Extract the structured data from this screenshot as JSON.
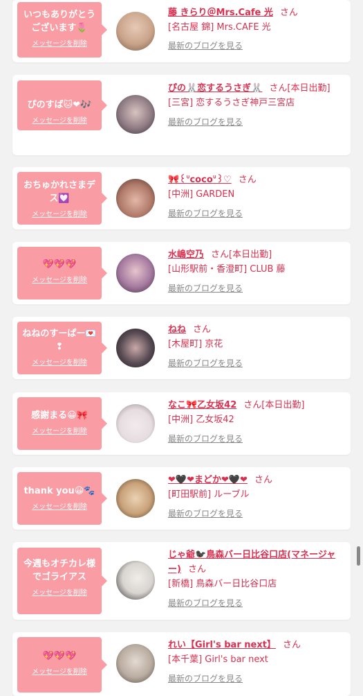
{
  "theme": {
    "accent": "#fa9ca4",
    "link": "#d9304f",
    "muted": "#888888"
  },
  "delete_label": "メッセージを削除",
  "blog_label": "最新のブログを見る",
  "san_label": "さん",
  "cards": [
    {
      "message": "いつもありがとうございます🌷",
      "name": "藤 きらり＠Mrs.Cafe 光",
      "status": "",
      "shop": "[名古屋 錦] Mrs.CAFE 光",
      "avatar_color": "#c9a48a"
    },
    {
      "message": "ぴのすば🐱❤🎶",
      "name": "ぴの🐰恋するうさぎ🐰",
      "status": "[本日出勤]",
      "shop": "[三宮] 恋するうさぎ神戸三宮店",
      "avatar_color": "#8f7c84"
    },
    {
      "message": "おちゅかれさまデス💟",
      "name": "🎀꒰ᐡcocoᐡ꒱♡",
      "status": "",
      "shop": "[中洲] GARDEN",
      "avatar_color": "#b07a6a"
    },
    {
      "message": "💖💖💖",
      "name": "水嶋空乃",
      "status": "[本日出勤]",
      "shop": "[山形駅前・香澄町] CLUB 藤",
      "avatar_color": "#a57aa0"
    },
    {
      "message": "ねねのすーぱー💌 ❢",
      "name": "ねね",
      "status": "",
      "shop": "[木屋町] 京花",
      "avatar_color": "#5a4c55"
    },
    {
      "message": "感謝まる😀🎀",
      "name": "なこ🎀乙女坂42",
      "status": "[本日出勤]",
      "shop": "[中洲] 乙女坂42",
      "avatar_color": "#e6dde0"
    },
    {
      "message": "thank you😀🐾",
      "name": "❤🖤❤まどか❤🖤❤",
      "status": "",
      "shop": "[町田駅前] ルーブル",
      "avatar_color": "#c9a27a"
    },
    {
      "message": "今週もオチカレ様でゴライアス",
      "name": "じゃ爺🐦‍⬛鳥森バー日比谷口店(マネージャー)",
      "status": "",
      "shop": "[新橋] 鳥森バー日比谷口店",
      "avatar_color": "#d8d4d0"
    },
    {
      "message": "💖💖💖",
      "name": "れい【Girl's bar next】",
      "status": "",
      "shop": "[本千葉] Girl's bar next",
      "avatar_color": "#b9aca0"
    }
  ]
}
